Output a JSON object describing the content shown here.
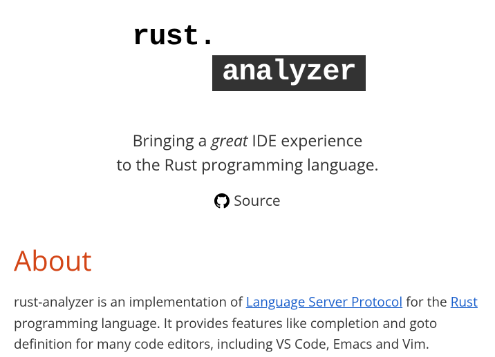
{
  "logo": {
    "top": "rust.",
    "bottom": "analyzer"
  },
  "tagline": {
    "line1_pre": "Bringing a ",
    "line1_em": "great",
    "line1_post": " IDE experience",
    "line2": "to the Rust programming language."
  },
  "source": {
    "label": "Source"
  },
  "about": {
    "heading": "About",
    "text_pre": "rust-analyzer is an implementation of ",
    "link1": "Language Server Protocol",
    "text_mid": " for the ",
    "link2": "Rust",
    "text_post": " programming language. It provides features like completion and goto definition for many code editors, including VS Code, Emacs and Vim."
  }
}
